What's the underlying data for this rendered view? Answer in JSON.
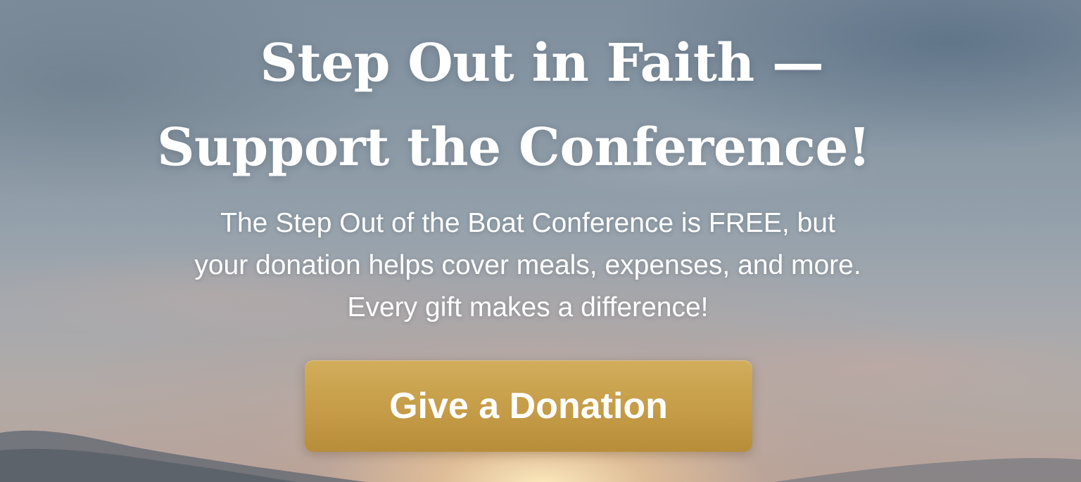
{
  "hero": {
    "title_line_1": "Step Out in Faith —",
    "title_line_2": "Support the Conference!",
    "subtitle_line_1": "The Step Out of the Boat Conference is FREE, but",
    "subtitle_line_2": "your donation helps cover meals, expenses, and more.",
    "subtitle_line_3": "Every gift makes a difference!",
    "button_label": "Give a Donation"
  },
  "colors": {
    "button_gold": "#c59c47",
    "text": "#ffffff"
  }
}
